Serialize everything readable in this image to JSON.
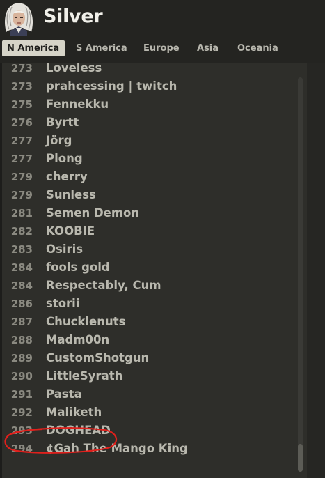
{
  "header": {
    "title": "Silver"
  },
  "tabs": [
    {
      "label": "N America",
      "active": true
    },
    {
      "label": "S America",
      "active": false
    },
    {
      "label": "Europe",
      "active": false
    },
    {
      "label": "Asia",
      "active": false
    },
    {
      "label": "Oceania",
      "active": false
    }
  ],
  "leaderboard": {
    "rows": [
      {
        "rank": "273",
        "name": "Loveless"
      },
      {
        "rank": "273",
        "name": "prahcessing | twitch"
      },
      {
        "rank": "275",
        "name": "Fennekku"
      },
      {
        "rank": "276",
        "name": "Byrtt"
      },
      {
        "rank": "277",
        "name": "Jörg"
      },
      {
        "rank": "277",
        "name": "Plong"
      },
      {
        "rank": "279",
        "name": "cherry"
      },
      {
        "rank": "279",
        "name": "Sunless"
      },
      {
        "rank": "281",
        "name": "Semen Demon"
      },
      {
        "rank": "282",
        "name": "KOOBIE"
      },
      {
        "rank": "283",
        "name": "Osiris"
      },
      {
        "rank": "284",
        "name": "fools gold"
      },
      {
        "rank": "284",
        "name": "Respectably, Cum"
      },
      {
        "rank": "286",
        "name": "storii"
      },
      {
        "rank": "287",
        "name": "Chucklenuts"
      },
      {
        "rank": "288",
        "name": "Madm00n"
      },
      {
        "rank": "289",
        "name": "CustomShotgun"
      },
      {
        "rank": "290",
        "name": "LittleSyrath"
      },
      {
        "rank": "291",
        "name": "Pasta"
      },
      {
        "rank": "292",
        "name": "Maliketh"
      },
      {
        "rank": "293",
        "name": "DOGHEAD"
      },
      {
        "rank": "294",
        "name": "¢Gah The Mango King"
      }
    ],
    "highlighted_rank": "293"
  },
  "colors": {
    "background": "#242421",
    "panel": "#2e2e2a",
    "active_tab": "#d6d4c8",
    "text": "#b9b8ae",
    "rank_text": "#8a8980",
    "highlight_circle": "#e0201c"
  },
  "icons": {
    "avatar": "player-avatar-portrait"
  }
}
